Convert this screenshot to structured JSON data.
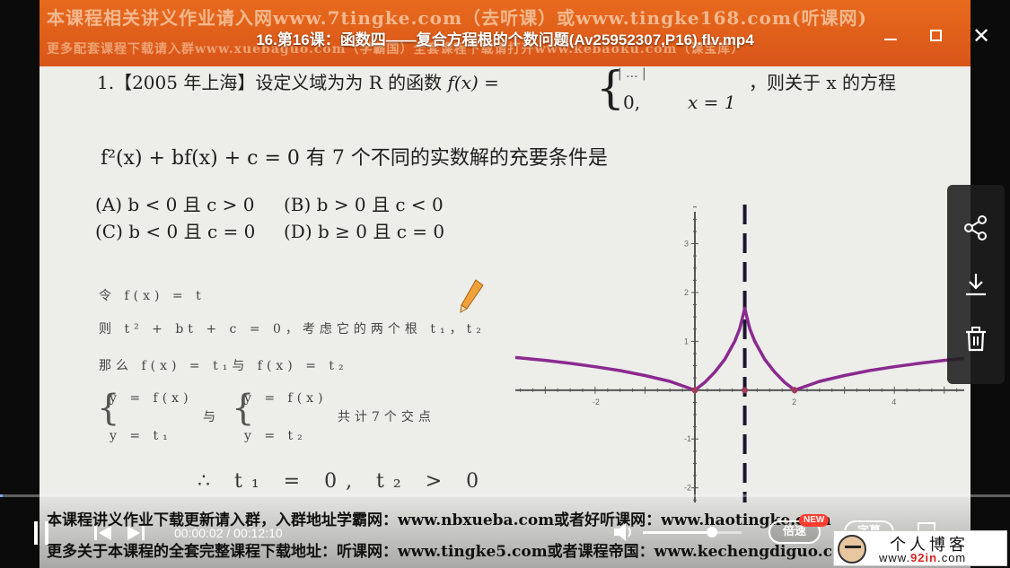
{
  "window": {
    "title": "16.第16课：函数四——复合方程根的个数问题(Av25952307,P16).flv.mp4",
    "minimize_label": "minimize",
    "maximize_label": "maximize",
    "close_glyph": "✕"
  },
  "banner": {
    "line1": "本课程相关讲义作业请入网www.7tingke.com（去听课）或www.tingke168.com(听课网)",
    "line2": "更多配套课程下载请入群www.xuebaguo.com（学霸国）全套课程下载请打开www.kebaoku.com（课宝库）"
  },
  "problem": {
    "q1_prefix": "1.【2005 年上海】设定义域为为 R 的函数",
    "q1_func": "f(x) =",
    "piece_top": "| ... |",
    "piece_zero": "0,",
    "piece_x1": "x = 1",
    "q1_tail": "，则关于 x 的方程",
    "equation": "f²(x) + bf(x) + c = 0 有 7 个不同的实数解的充要条件是",
    "option_a": "(A) b < 0 且 c > 0",
    "option_b": "(B) b > 0 且 c < 0",
    "option_c": "(C) b < 0 且 c = 0",
    "option_d": "(D) b ≥ 0 且 c = 0"
  },
  "handwritten": {
    "line1": "令 f(x) = t",
    "line2": "则 t² + bt + c = 0，考虑它的两个根 t₁，t₂",
    "line3": "那么 f(x) = t₁与 f(x) = t₂",
    "sys1_a": "y = f(x)",
    "sys1_b": "y = t₁",
    "and": "与",
    "sys2_a": "y = f(x)",
    "sys2_b": "y = t₂",
    "count": "共计7个交点",
    "conclusion": "∴ t₁ = 0, t₂ > 0"
  },
  "chart_data": {
    "type": "line",
    "x_ticks": [
      "-2",
      "2",
      "4"
    ],
    "y_ticks": [
      "3",
      "2",
      "1",
      "-1",
      "-2"
    ],
    "xlim": [
      -3.6,
      5.4
    ],
    "ylim": [
      -2.3,
      3.8
    ],
    "asymptote_x": 1,
    "series": [
      {
        "color": "#8a2a8f",
        "x": [
          -3.6,
          -3,
          -2.5,
          -2,
          -1.5,
          -1,
          -0.5,
          0,
          0.2,
          0.4,
          0.6,
          0.8,
          0.9,
          0.97,
          1,
          1.03,
          1.1,
          1.2,
          1.4,
          1.6,
          1.8,
          2,
          2.5,
          3,
          3.5,
          4,
          4.5,
          5,
          5.4
        ],
        "y": [
          0.67,
          0.61,
          0.55,
          0.48,
          0.4,
          0.3,
          0.18,
          0,
          0.16,
          0.37,
          0.63,
          1.0,
          1.26,
          1.55,
          1.68,
          1.55,
          1.26,
          1.0,
          0.63,
          0.37,
          0.16,
          0,
          0.18,
          0.3,
          0.4,
          0.48,
          0.55,
          0.61,
          0.65
        ]
      }
    ],
    "points": [
      {
        "x": 0,
        "y": 0
      },
      {
        "x": 1,
        "y": 0
      },
      {
        "x": 2,
        "y": 0
      }
    ]
  },
  "subtitles": {
    "line1": "本课程讲义作业下载更新请入群，入群地址学霸网：www.nbxueba.com或者好听课网：www.haotingke.com",
    "line2": "更多关于本课程的全套完整课程下载地址：听课网：www.tingke5.com或者课程帝国：www.kechengdiguo.com"
  },
  "player": {
    "current_time": "00:00:02",
    "total_time": "00:12:10",
    "time_sep": " / ",
    "progress": 0.003,
    "volume": 0.65,
    "speed_label": "倍速",
    "new_badge": "NEW",
    "subtitle_label": "字幕",
    "more_glyph": "⋯"
  },
  "side_panel": {
    "share_icon": "share-icon",
    "download_icon": "download-icon",
    "delete_icon": "trash-icon"
  },
  "logo": {
    "name": "个人博客",
    "url_prefix": "www.",
    "url_highlight": "92in",
    "url_suffix": ".com"
  }
}
